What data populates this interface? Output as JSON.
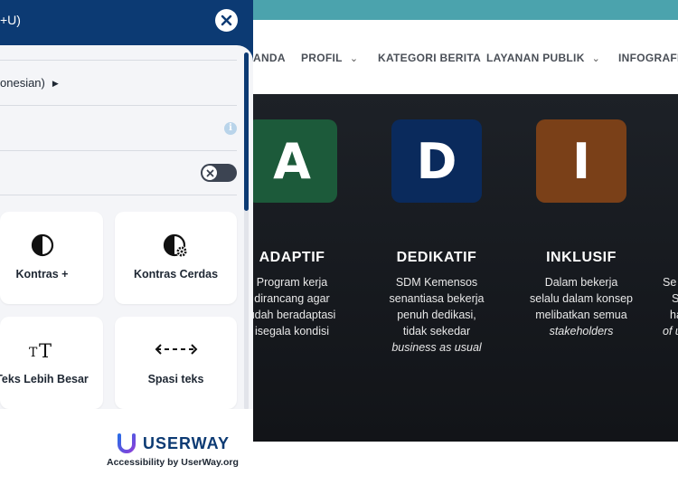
{
  "panel": {
    "header_title": "+U)",
    "language": "onesian)",
    "cards": [
      {
        "label": "Kontras +",
        "icon": "contrast-icon"
      },
      {
        "label": "Kontras Cerdas",
        "icon": "smart-contrast-icon"
      },
      {
        "label": "Teks Lebih Besar",
        "icon": "bigger-text-icon"
      },
      {
        "label": "Spasi teks",
        "icon": "text-spacing-icon"
      }
    ],
    "brand": "USERWAY",
    "brand_sub": "Accessibility by UserWay.org",
    "info_glyph": "i",
    "toggle_state": "off"
  },
  "site": {
    "nav": [
      {
        "label": "ANDA",
        "has_dropdown": false
      },
      {
        "label": "PROFIL",
        "has_dropdown": true
      },
      {
        "label": "KATEGORI BERITA",
        "has_dropdown": false
      },
      {
        "label": "LAYANAN PUBLIK",
        "has_dropdown": true
      },
      {
        "label": "INFOGRAFIS",
        "has_dropdown": false
      }
    ],
    "values": [
      {
        "letter": "A",
        "title": "ADAPTIF",
        "lines": [
          "Program kerja",
          "dirancang agar",
          "udah beradaptasi",
          "isegala kondisi"
        ],
        "color": "#1c5a3a"
      },
      {
        "letter": "D",
        "title": "DEDIKATIF",
        "lines": [
          "SDM Kemensos",
          "senantiasa bekerja",
          "penuh dedikasi,",
          "tidak sekedar"
        ],
        "italic_line": "business as usual",
        "color": "#0a2a5c"
      },
      {
        "letter": "I",
        "title": "INKLUSIF",
        "lines": [
          "Dalam bekerja",
          "selalu dalam konsep",
          "melibatkan semua"
        ],
        "italic_line": "stakeholders",
        "color": "#7a4018"
      },
      {
        "letter": "",
        "title": "",
        "lines": [
          "Se",
          "S",
          "ha"
        ],
        "italic_line": "of u",
        "color": "#1d2127"
      }
    ],
    "colors": {
      "topbar": "#4ba3ad",
      "panel": "#0c3a73",
      "dot_active": "#2f8fd8",
      "dot_inactive": "#3a3f48"
    }
  }
}
